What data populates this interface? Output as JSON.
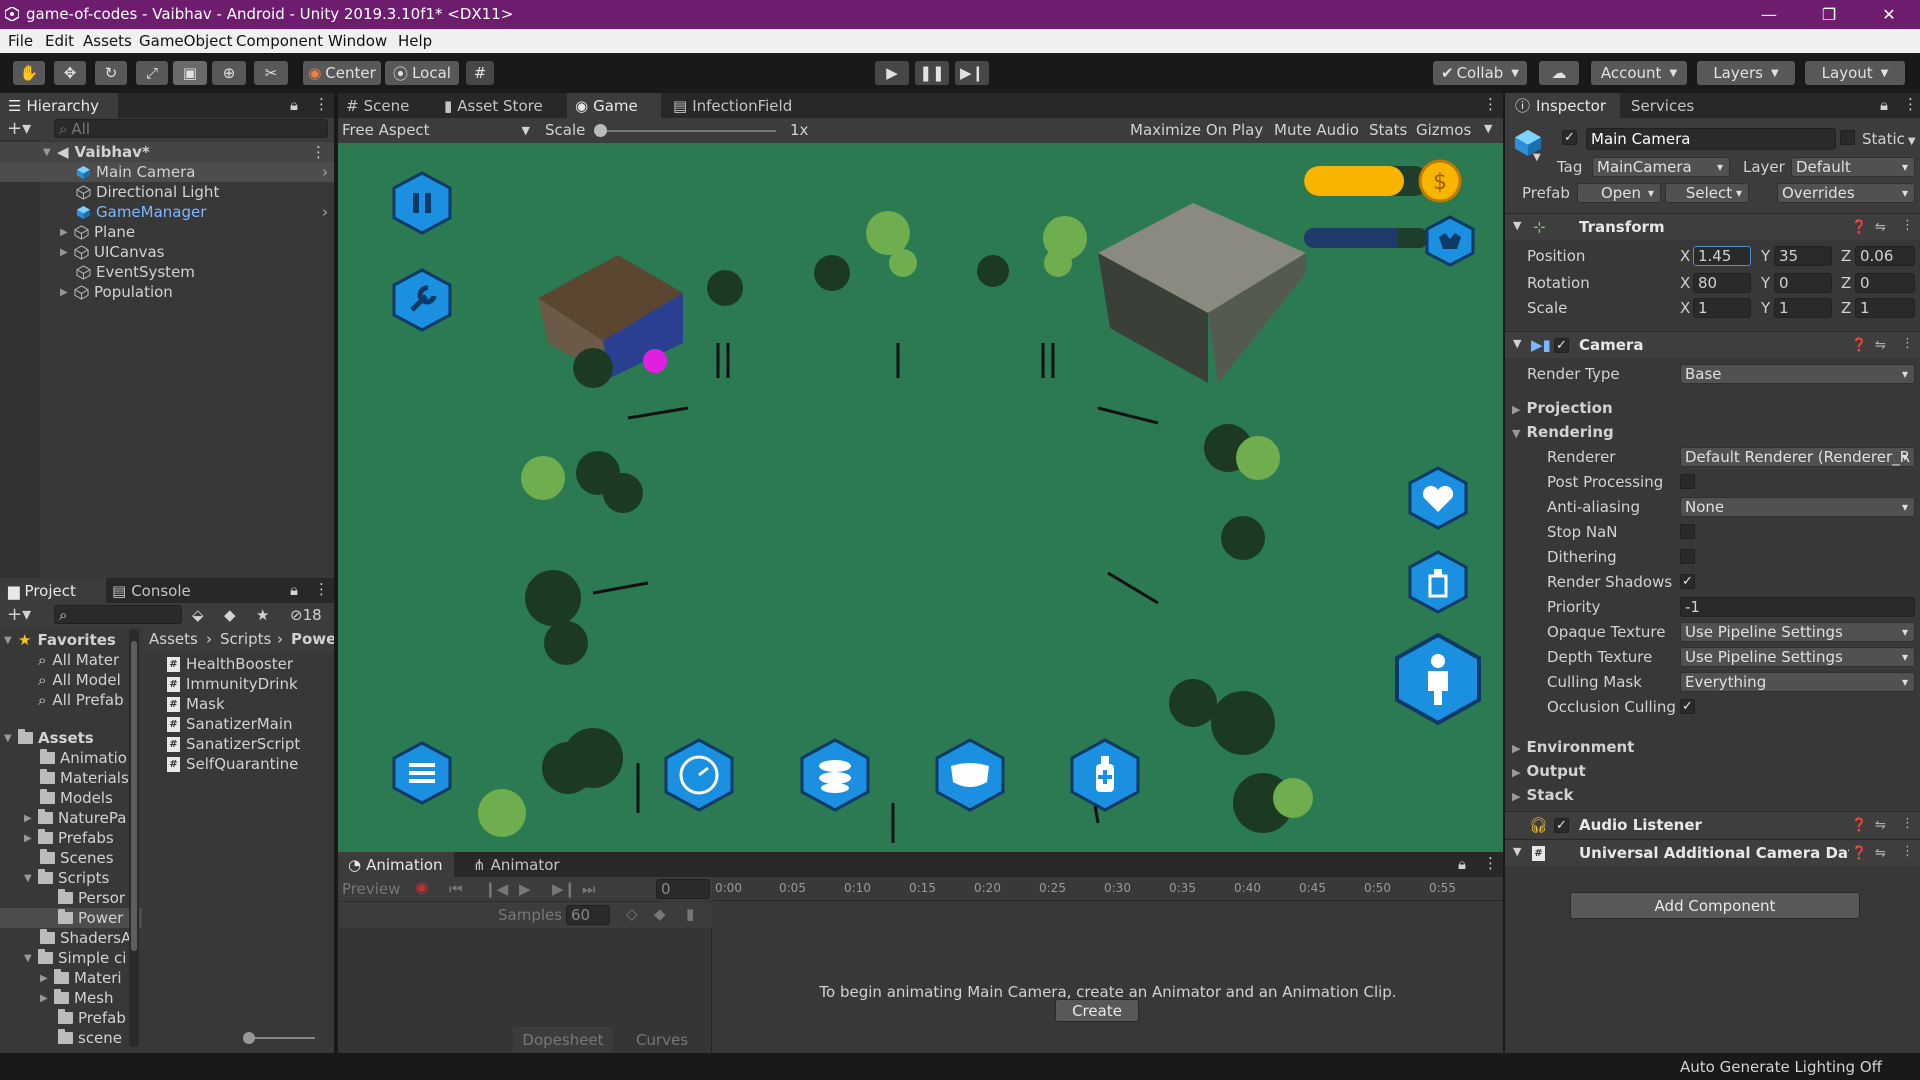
{
  "window": {
    "title": "game-of-codes - Vaibhav - Android - Unity 2019.3.10f1* <DX11>",
    "controls": {
      "minimize": "—",
      "restore": "❐",
      "close": "✕"
    }
  },
  "menu": [
    "File",
    "Edit",
    "Assets",
    "GameObject",
    "Component",
    "Window",
    "Help"
  ],
  "toolbar": {
    "pivot": "Center",
    "space": "Local",
    "collab": "Collab",
    "account": "Account",
    "layers": "Layers",
    "layout": "Layout"
  },
  "hierarchy": {
    "tab": "Hierarchy",
    "search_placeholder": "All",
    "scene": "Vaibhav*",
    "items": [
      "Main Camera",
      "Directional Light",
      "GameManager",
      "Plane",
      "UICanvas",
      "EventSystem",
      "Population"
    ]
  },
  "project": {
    "tabs": [
      "Project",
      "Console"
    ],
    "hidden_count": "18",
    "favorites_label": "Favorites",
    "favorites": [
      "All Mater",
      "All Model",
      "All Prefab"
    ],
    "assets_label": "Assets",
    "tree": [
      "Animatio",
      "Materials",
      "Models",
      "NaturePa",
      "Prefabs",
      "Scenes",
      "Scripts",
      "Persor",
      "Power",
      "ShadersA",
      "Simple ci",
      "Materi",
      "Mesh",
      "Prefab",
      "scene"
    ],
    "breadcrumb": [
      "Assets",
      "Scripts",
      "Powe"
    ],
    "files": [
      "HealthBooster",
      "ImmunityDrink",
      "Mask",
      "SanatizerMain",
      "SanatizerScript",
      "SelfQuarantine"
    ]
  },
  "scene_tabs": [
    "Scene",
    "Asset Store",
    "Game",
    "InfectionField"
  ],
  "game_bar": {
    "aspect": "Free Aspect",
    "scale_label": "Scale",
    "scale_value": "1x",
    "maximize": "Maximize On Play",
    "mute": "Mute Audio",
    "stats": "Stats",
    "gizmos": "Gizmos"
  },
  "hud": {
    "coin_fill": 0.8,
    "health_fill": 0.75
  },
  "animation": {
    "tabs": [
      "Animation",
      "Animator"
    ],
    "preview": "Preview",
    "frame": "0",
    "samples_label": "Samples",
    "samples_value": "60",
    "timeline": [
      "0:00",
      "0:05",
      "0:10",
      "0:15",
      "0:20",
      "0:25",
      "0:30",
      "0:35",
      "0:40",
      "0:45",
      "0:50",
      "0:55"
    ],
    "message": "To begin animating Main Camera, create an Animator and an Animation Clip.",
    "create": "Create",
    "dopesheet": "Dopesheet",
    "curves": "Curves"
  },
  "inspector": {
    "tabs": [
      "Inspector",
      "Services"
    ],
    "name": "Main Camera",
    "static": "Static",
    "tag_label": "Tag",
    "tag": "MainCamera",
    "layer_label": "Layer",
    "layer": "Default",
    "prefab_label": "Prefab",
    "prefab_open": "Open",
    "prefab_select": "Select",
    "prefab_overrides": "Overrides",
    "transform": {
      "title": "Transform",
      "position_label": "Position",
      "rotation_label": "Rotation",
      "scale_label": "Scale",
      "position": {
        "x": "1.45",
        "y": "35",
        "z": "0.06"
      },
      "rotation": {
        "x": "80",
        "y": "0",
        "z": "0"
      },
      "scale": {
        "x": "1",
        "y": "1",
        "z": "1"
      }
    },
    "camera": {
      "title": "Camera",
      "render_type_label": "Render Type",
      "render_type": "Base",
      "projection": "Projection",
      "rendering": "Rendering",
      "renderer_label": "Renderer",
      "renderer": "Default Renderer (Renderer_R",
      "post_processing": "Post Processing",
      "anti_aliasing_label": "Anti-aliasing",
      "anti_aliasing": "None",
      "stop_nan": "Stop NaN",
      "dithering": "Dithering",
      "render_shadows": "Render Shadows",
      "priority_label": "Priority",
      "priority": "-1",
      "opaque_label": "Opaque Texture",
      "opaque": "Use Pipeline Settings",
      "depth_label": "Depth Texture",
      "depth": "Use Pipeline Settings",
      "culling_label": "Culling Mask",
      "culling": "Everything",
      "occlusion": "Occlusion Culling",
      "environment": "Environment",
      "output": "Output",
      "stack": "Stack"
    },
    "audio_listener": "Audio Listener",
    "urp_data": "Universal Additional Camera Data (",
    "add_component": "Add Component"
  },
  "status": "Auto Generate Lighting Off",
  "colors": {
    "titlebar": "#6d1c6e",
    "game_bg": "#2b7a52",
    "hex_blue": "#1b8fe0",
    "coin_bar": "#f7b500",
    "selection": "#4d4d4d"
  }
}
